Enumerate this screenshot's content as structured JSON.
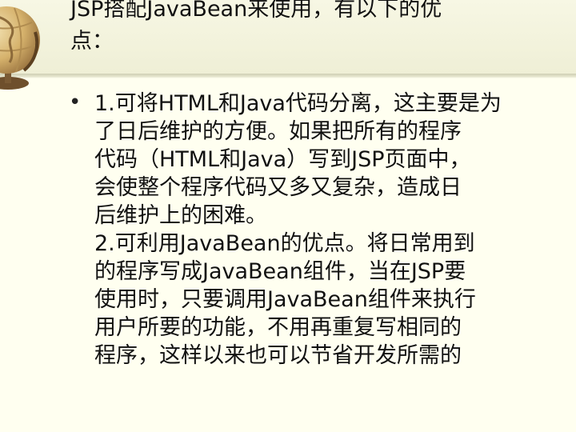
{
  "slide": {
    "title_lines": [
      "JSP搭配JavaBean来使用，有以下的优",
      "点："
    ],
    "bullet_char": "•",
    "body_lines": [
      "1.可将HTML和Java代码分离，这主要是为",
      "了日后维护的方便。如果把所有的程序",
      "代码（HTML和Java）写到JSP页面中，",
      "会使整个程序代码又多又复杂，造成日",
      "后维护上的困难。",
      "2.可利用JavaBean的优点。将日常用到",
      "的程序写成JavaBean组件，当在JSP要",
      "使用时，只要调用JavaBean组件来执行",
      "用户所要的功能，不用再重复写相同的",
      "程序，这样以来也可以节省开发所需的"
    ]
  },
  "colors": {
    "background": "#fffff0",
    "title_band": "#f2f2dc",
    "text": "#111111"
  },
  "icons": {
    "decoration": "globe-icon"
  }
}
